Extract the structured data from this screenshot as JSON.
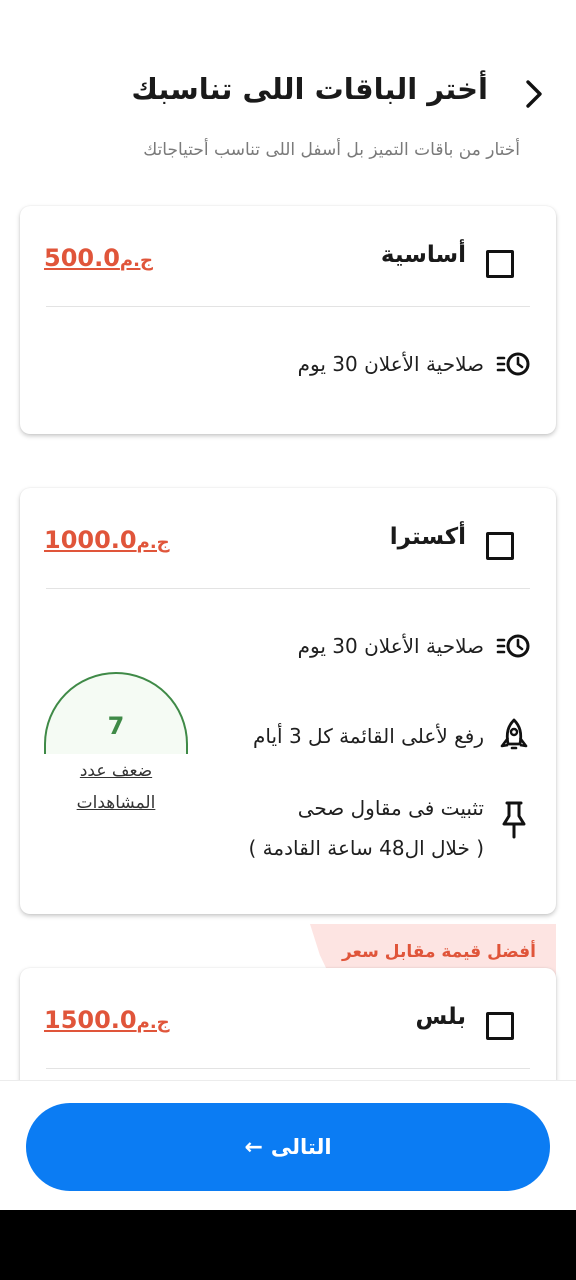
{
  "header": {
    "title": "أختر الباقات اللى تناسبك",
    "subtitle": "أختار من باقات التميز بل أسفل اللى تناسب أحتياجاتك"
  },
  "packages": [
    {
      "name": "أساسية",
      "price": "500.0",
      "currency": "ج.م",
      "features": [
        "صلاحية الأعلان 30 يوم"
      ]
    },
    {
      "name": "أكسترا",
      "price": "1000.0",
      "currency": "ج.م",
      "features": [
        "صلاحية الأعلان 30 يوم",
        "رفع لأعلى القائمة كل 3 أيام",
        "تثبيت فى مقاول صحى",
        "( خلال ال48 ساعة القادمة )"
      ],
      "views_multiplier": "7",
      "views_label_1": "ضعف عدد",
      "views_label_2": "المشاهدات"
    },
    {
      "name": "بلس",
      "price": "1500.0",
      "currency": "ج.م",
      "badge": "أفضل قيمة مقابل سعر"
    }
  ],
  "next_button": {
    "label": "التالى",
    "arrow": "←"
  },
  "colors": {
    "accent": "#0b7cf3",
    "price": "#e0553a",
    "gauge": "#3f8a47",
    "badge_bg": "#fde4e2"
  },
  "icons": [
    "chevron-right-icon",
    "timer-icon",
    "rocket-icon",
    "pin-icon",
    "arrow-left-icon"
  ]
}
